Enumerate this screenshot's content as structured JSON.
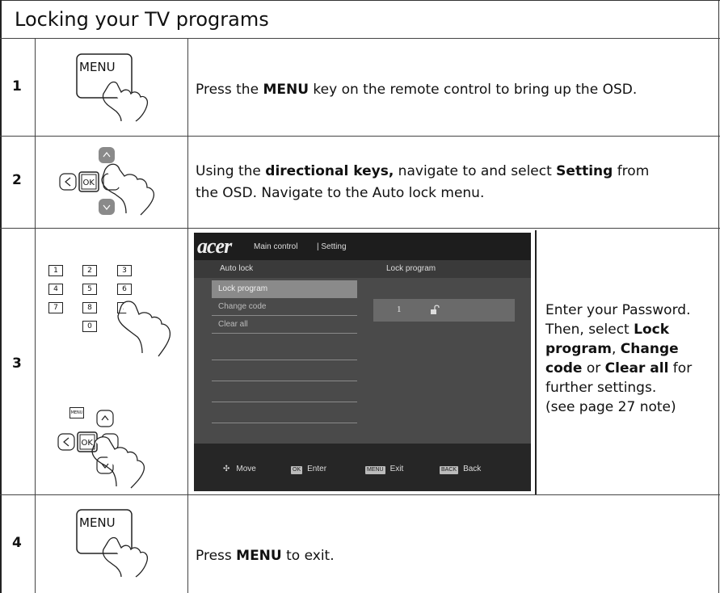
{
  "title": "Locking your TV programs",
  "steps": [
    {
      "number": "1",
      "key_label": "MENU",
      "desc_parts": [
        "Press the ",
        "MENU",
        " key on the remote control to bring up the OSD."
      ]
    },
    {
      "number": "2",
      "ok_label": "OK",
      "desc_line1_parts": [
        "Using the ",
        "directional keys,",
        " navigate to and select ",
        "Setting",
        " from"
      ],
      "desc_line2": "the OSD.  Navigate to the Auto lock menu."
    },
    {
      "number": "3",
      "keypad": [
        "1",
        "2",
        "3",
        "4",
        "5",
        "6",
        "7",
        "8",
        "9",
        "0"
      ],
      "menu_small": "MENU",
      "ok_label": "OK",
      "desc_lines": [
        {
          "plain": "Enter your Password."
        },
        {
          "plain": "Then, select ",
          "bold": "Lock"
        },
        {
          "bold": "program",
          "plain": ", ",
          "bold2": "Change"
        },
        {
          "bold": "code",
          "plain": " or ",
          "bold2": "Clear all",
          "plain2": " for"
        },
        {
          "plain": "further settings."
        },
        {
          "plain": "(see page 27 note)"
        }
      ]
    },
    {
      "number": "4",
      "key_label": "MENU",
      "desc_parts": [
        "Press ",
        "MENU",
        " to exit."
      ]
    }
  ],
  "osd": {
    "logo": "acer",
    "main_control": "Main control",
    "setting": "| Setting",
    "auto_lock": "Auto lock",
    "lock_program_header": "Lock program",
    "menu_items": [
      "Lock program",
      "Change code",
      "Clear all",
      "",
      "",
      "",
      ""
    ],
    "code_value": "1",
    "lock_icon": "unlock-icon",
    "footer": [
      {
        "icon": "move-icon",
        "badge": "",
        "label": "Move"
      },
      {
        "icon": "ok-badge",
        "badge": "OK",
        "label": "Enter"
      },
      {
        "icon": "menu-badge",
        "badge": "MENU",
        "label": "Exit"
      },
      {
        "icon": "back-badge",
        "badge": "BACK",
        "label": "Back"
      }
    ]
  }
}
